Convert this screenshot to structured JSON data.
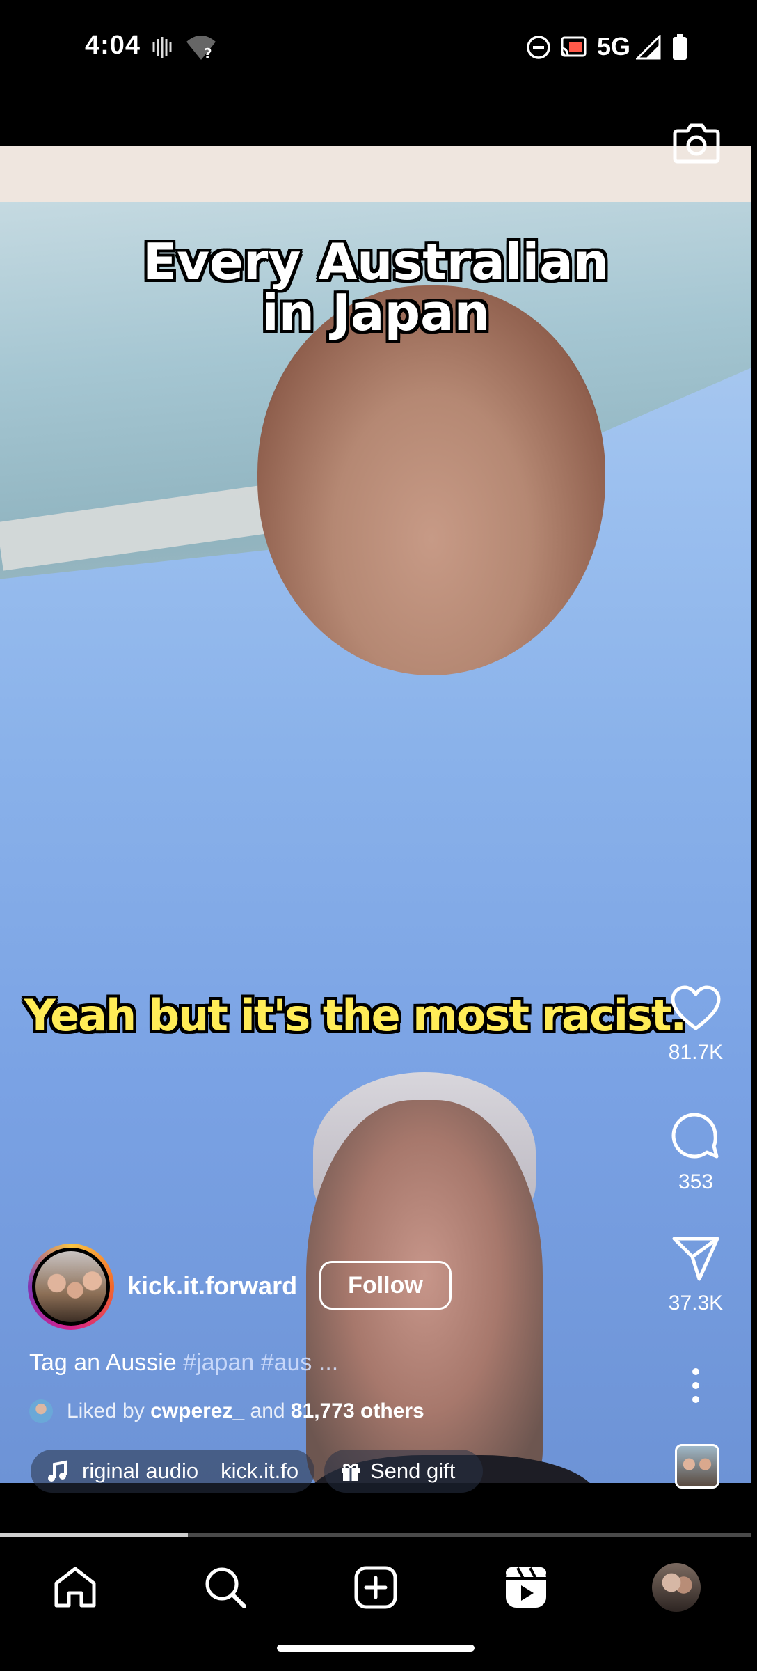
{
  "status_bar": {
    "time": "4:04",
    "network": "5G"
  },
  "video": {
    "caption_top": "Every Australian\nin Japan",
    "caption_subtitle": "Yeah but it's the most racist.",
    "progress": 0.25
  },
  "actions": {
    "likes": "81.7K",
    "comments": "353",
    "shares": "37.3K"
  },
  "author": {
    "username": "kick.it.forward",
    "follow_label": "Follow"
  },
  "post": {
    "caption_text": "Tag an Aussie",
    "hashtags": "#japan #aus ...",
    "liked_prefix": "Liked by",
    "liked_user": "cwperez_",
    "liked_and": "and",
    "liked_others": "81,773 others"
  },
  "audio": {
    "label": "riginal audio",
    "artist": "kick.it.fo",
    "gift_label": "Send gift"
  },
  "nav": {
    "items": [
      "home-icon",
      "search-icon",
      "create-icon",
      "reels-icon",
      "profile-avatar"
    ]
  }
}
